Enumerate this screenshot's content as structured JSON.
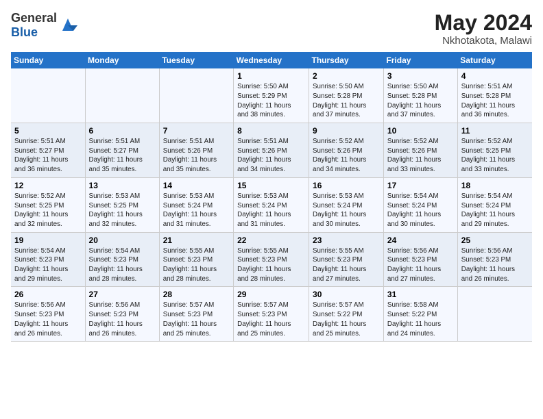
{
  "header": {
    "logo_general": "General",
    "logo_blue": "Blue",
    "month_year": "May 2024",
    "location": "Nkhotakota, Malawi"
  },
  "days_of_week": [
    "Sunday",
    "Monday",
    "Tuesday",
    "Wednesday",
    "Thursday",
    "Friday",
    "Saturday"
  ],
  "weeks": [
    [
      {
        "day": "",
        "info": ""
      },
      {
        "day": "",
        "info": ""
      },
      {
        "day": "",
        "info": ""
      },
      {
        "day": "1",
        "info": "Sunrise: 5:50 AM\nSunset: 5:29 PM\nDaylight: 11 hours\nand 38 minutes."
      },
      {
        "day": "2",
        "info": "Sunrise: 5:50 AM\nSunset: 5:28 PM\nDaylight: 11 hours\nand 37 minutes."
      },
      {
        "day": "3",
        "info": "Sunrise: 5:50 AM\nSunset: 5:28 PM\nDaylight: 11 hours\nand 37 minutes."
      },
      {
        "day": "4",
        "info": "Sunrise: 5:51 AM\nSunset: 5:28 PM\nDaylight: 11 hours\nand 36 minutes."
      }
    ],
    [
      {
        "day": "5",
        "info": "Sunrise: 5:51 AM\nSunset: 5:27 PM\nDaylight: 11 hours\nand 36 minutes."
      },
      {
        "day": "6",
        "info": "Sunrise: 5:51 AM\nSunset: 5:27 PM\nDaylight: 11 hours\nand 35 minutes."
      },
      {
        "day": "7",
        "info": "Sunrise: 5:51 AM\nSunset: 5:26 PM\nDaylight: 11 hours\nand 35 minutes."
      },
      {
        "day": "8",
        "info": "Sunrise: 5:51 AM\nSunset: 5:26 PM\nDaylight: 11 hours\nand 34 minutes."
      },
      {
        "day": "9",
        "info": "Sunrise: 5:52 AM\nSunset: 5:26 PM\nDaylight: 11 hours\nand 34 minutes."
      },
      {
        "day": "10",
        "info": "Sunrise: 5:52 AM\nSunset: 5:26 PM\nDaylight: 11 hours\nand 33 minutes."
      },
      {
        "day": "11",
        "info": "Sunrise: 5:52 AM\nSunset: 5:25 PM\nDaylight: 11 hours\nand 33 minutes."
      }
    ],
    [
      {
        "day": "12",
        "info": "Sunrise: 5:52 AM\nSunset: 5:25 PM\nDaylight: 11 hours\nand 32 minutes."
      },
      {
        "day": "13",
        "info": "Sunrise: 5:53 AM\nSunset: 5:25 PM\nDaylight: 11 hours\nand 32 minutes."
      },
      {
        "day": "14",
        "info": "Sunrise: 5:53 AM\nSunset: 5:24 PM\nDaylight: 11 hours\nand 31 minutes."
      },
      {
        "day": "15",
        "info": "Sunrise: 5:53 AM\nSunset: 5:24 PM\nDaylight: 11 hours\nand 31 minutes."
      },
      {
        "day": "16",
        "info": "Sunrise: 5:53 AM\nSunset: 5:24 PM\nDaylight: 11 hours\nand 30 minutes."
      },
      {
        "day": "17",
        "info": "Sunrise: 5:54 AM\nSunset: 5:24 PM\nDaylight: 11 hours\nand 30 minutes."
      },
      {
        "day": "18",
        "info": "Sunrise: 5:54 AM\nSunset: 5:24 PM\nDaylight: 11 hours\nand 29 minutes."
      }
    ],
    [
      {
        "day": "19",
        "info": "Sunrise: 5:54 AM\nSunset: 5:23 PM\nDaylight: 11 hours\nand 29 minutes."
      },
      {
        "day": "20",
        "info": "Sunrise: 5:54 AM\nSunset: 5:23 PM\nDaylight: 11 hours\nand 28 minutes."
      },
      {
        "day": "21",
        "info": "Sunrise: 5:55 AM\nSunset: 5:23 PM\nDaylight: 11 hours\nand 28 minutes."
      },
      {
        "day": "22",
        "info": "Sunrise: 5:55 AM\nSunset: 5:23 PM\nDaylight: 11 hours\nand 28 minutes."
      },
      {
        "day": "23",
        "info": "Sunrise: 5:55 AM\nSunset: 5:23 PM\nDaylight: 11 hours\nand 27 minutes."
      },
      {
        "day": "24",
        "info": "Sunrise: 5:56 AM\nSunset: 5:23 PM\nDaylight: 11 hours\nand 27 minutes."
      },
      {
        "day": "25",
        "info": "Sunrise: 5:56 AM\nSunset: 5:23 PM\nDaylight: 11 hours\nand 26 minutes."
      }
    ],
    [
      {
        "day": "26",
        "info": "Sunrise: 5:56 AM\nSunset: 5:23 PM\nDaylight: 11 hours\nand 26 minutes."
      },
      {
        "day": "27",
        "info": "Sunrise: 5:56 AM\nSunset: 5:23 PM\nDaylight: 11 hours\nand 26 minutes."
      },
      {
        "day": "28",
        "info": "Sunrise: 5:57 AM\nSunset: 5:23 PM\nDaylight: 11 hours\nand 25 minutes."
      },
      {
        "day": "29",
        "info": "Sunrise: 5:57 AM\nSunset: 5:23 PM\nDaylight: 11 hours\nand 25 minutes."
      },
      {
        "day": "30",
        "info": "Sunrise: 5:57 AM\nSunset: 5:22 PM\nDaylight: 11 hours\nand 25 minutes."
      },
      {
        "day": "31",
        "info": "Sunrise: 5:58 AM\nSunset: 5:22 PM\nDaylight: 11 hours\nand 24 minutes."
      },
      {
        "day": "",
        "info": ""
      }
    ]
  ]
}
